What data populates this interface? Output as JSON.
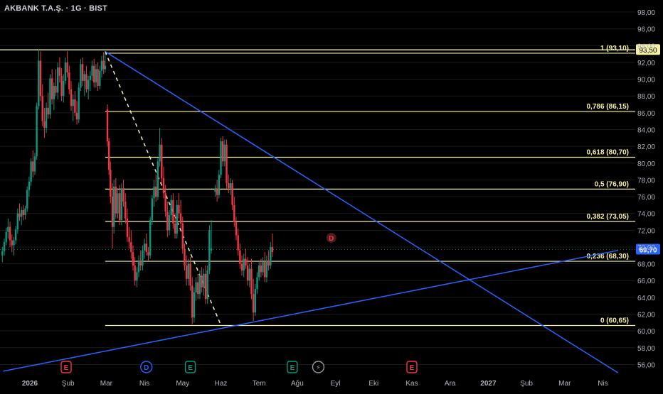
{
  "header": {
    "title": "AKBANK T.A.Ş. · 1G · BIST"
  },
  "colors": {
    "background": "#000000",
    "grid": "#1a1a1a",
    "axis_text": "#b2b5be",
    "up": "#089981",
    "down": "#f23645",
    "fib_line": "#f5f0a6",
    "trend_line": "#2962ff",
    "dashed_line": "#f5f0c0",
    "price_label_bg": "#f5f0a6",
    "current_label_bg": "#2962ff"
  },
  "chart_data": {
    "type": "candlestick",
    "symbol": "AKBANK T.A.Ş.",
    "interval": "1G",
    "exchange": "BIST",
    "y_axis": {
      "ylim": [
        55.2,
        99.0
      ],
      "ticks": [
        "98,00",
        "96,00",
        "94,00",
        "92,00",
        "90,00",
        "88,00",
        "86,00",
        "84,00",
        "82,00",
        "80,00",
        "78,00",
        "76,00",
        "74,00",
        "72,00",
        "70,00",
        "68,00",
        "66,00",
        "64,00",
        "62,00",
        "60,00",
        "58,00",
        "56,00"
      ]
    },
    "x_axis": {
      "labels": [
        {
          "text": "2026",
          "t": 0.0,
          "bold": true
        },
        {
          "text": "Şub",
          "t": 1.0
        },
        {
          "text": "Mar",
          "t": 2.0
        },
        {
          "text": "Nis",
          "t": 3.0
        },
        {
          "text": "May",
          "t": 4.0
        },
        {
          "text": "Haz",
          "t": 5.0
        },
        {
          "text": "Tem",
          "t": 6.0
        },
        {
          "text": "Ağu",
          "t": 7.0
        },
        {
          "text": "Eyl",
          "t": 8.0
        },
        {
          "text": "Eki",
          "t": 9.0
        },
        {
          "text": "Kas",
          "t": 10.0
        },
        {
          "text": "Ara",
          "t": 11.0
        },
        {
          "text": "2027",
          "t": 12.0,
          "bold": true
        },
        {
          "text": "Şub",
          "t": 13.0
        },
        {
          "text": "Mar",
          "t": 14.0
        },
        {
          "text": "Nis",
          "t": 15.0
        }
      ]
    },
    "fibonacci": [
      {
        "label": "1 (93,10)",
        "value": 93.1
      },
      {
        "label": "0,786 (86,15)",
        "value": 86.15
      },
      {
        "label": "0,618 (80,70)",
        "value": 80.7
      },
      {
        "label": "0,5 (76,90)",
        "value": 76.9
      },
      {
        "label": "0,382 (73,05)",
        "value": 73.05
      },
      {
        "label": "0,236 (68,30)",
        "value": 68.3
      },
      {
        "label": "0 (60,65)",
        "value": 60.65
      }
    ],
    "horizontal_level": {
      "value": 93.5,
      "label": "93,50"
    },
    "current_price": {
      "value": 69.7,
      "label": "69,70"
    },
    "trend_lines": [
      {
        "name": "descending",
        "points": [
          [
            1.97,
            93.3
          ],
          [
            15.4,
            55.0
          ]
        ]
      },
      {
        "name": "ascending",
        "points": [
          [
            -0.7,
            55.2
          ],
          [
            15.4,
            69.6
          ]
        ]
      }
    ],
    "dashed_line": {
      "points": [
        [
          1.97,
          93.3
        ],
        [
          5.0,
          60.7
        ]
      ]
    },
    "events": [
      {
        "letter": "E",
        "t": 0.95,
        "kind": "earnings-red"
      },
      {
        "letter": "D",
        "t": 3.05,
        "kind": "dividend-blue"
      },
      {
        "letter": "E",
        "t": 4.2,
        "kind": "earnings-green"
      },
      {
        "letter": "E",
        "t": 6.87,
        "kind": "earnings-green"
      },
      {
        "letter": "⚡",
        "t": 7.55,
        "kind": "split-grey"
      },
      {
        "letter": "E",
        "t": 10.0,
        "kind": "earnings-red"
      }
    ],
    "future_marker": {
      "letter": "D",
      "t": 7.89,
      "value": 71.1
    },
    "candles": [
      {
        "t": -0.72,
        "o": 69.0,
        "h": 70.0,
        "l": 68.2,
        "c": 69.5
      },
      {
        "t": -0.67,
        "o": 69.5,
        "h": 71.0,
        "l": 69.0,
        "c": 70.6
      },
      {
        "t": -0.62,
        "o": 70.6,
        "h": 72.3,
        "l": 70.2,
        "c": 71.8
      },
      {
        "t": -0.57,
        "o": 71.8,
        "h": 73.4,
        "l": 71.0,
        "c": 72.4
      },
      {
        "t": -0.52,
        "o": 72.4,
        "h": 73.0,
        "l": 70.0,
        "c": 70.8
      },
      {
        "t": -0.47,
        "o": 70.8,
        "h": 71.5,
        "l": 69.4,
        "c": 70.2
      },
      {
        "t": -0.42,
        "o": 70.2,
        "h": 71.2,
        "l": 69.0,
        "c": 70.8
      },
      {
        "t": -0.37,
        "o": 70.8,
        "h": 72.5,
        "l": 70.3,
        "c": 72.1
      },
      {
        "t": -0.32,
        "o": 72.1,
        "h": 74.6,
        "l": 71.6,
        "c": 74.0
      },
      {
        "t": -0.27,
        "o": 74.0,
        "h": 75.2,
        "l": 73.1,
        "c": 73.6
      },
      {
        "t": -0.22,
        "o": 73.6,
        "h": 74.8,
        "l": 72.6,
        "c": 74.4
      },
      {
        "t": -0.17,
        "o": 74.4,
        "h": 75.0,
        "l": 73.2,
        "c": 73.8
      },
      {
        "t": -0.12,
        "o": 73.8,
        "h": 74.9,
        "l": 73.3,
        "c": 74.6
      },
      {
        "t": -0.07,
        "o": 74.6,
        "h": 77.2,
        "l": 74.2,
        "c": 76.8
      },
      {
        "t": -0.02,
        "o": 76.8,
        "h": 78.4,
        "l": 76.0,
        "c": 77.8
      },
      {
        "t": 0.03,
        "o": 77.8,
        "h": 80.6,
        "l": 77.3,
        "c": 80.2
      },
      {
        "t": 0.08,
        "o": 80.2,
        "h": 81.5,
        "l": 78.3,
        "c": 79.0
      },
      {
        "t": 0.13,
        "o": 79.0,
        "h": 81.2,
        "l": 78.6,
        "c": 80.8
      },
      {
        "t": 0.18,
        "o": 80.8,
        "h": 87.2,
        "l": 80.4,
        "c": 86.8
      },
      {
        "t": 0.23,
        "o": 86.8,
        "h": 93.6,
        "l": 86.4,
        "c": 92.2
      },
      {
        "t": 0.28,
        "o": 92.2,
        "h": 93.3,
        "l": 87.4,
        "c": 88.0
      },
      {
        "t": 0.33,
        "o": 88.0,
        "h": 89.4,
        "l": 84.4,
        "c": 85.0
      },
      {
        "t": 0.38,
        "o": 85.0,
        "h": 86.6,
        "l": 83.0,
        "c": 84.2
      },
      {
        "t": 0.43,
        "o": 84.2,
        "h": 87.2,
        "l": 83.6,
        "c": 86.6
      },
      {
        "t": 0.48,
        "o": 86.6,
        "h": 88.4,
        "l": 85.3,
        "c": 85.8
      },
      {
        "t": 0.53,
        "o": 85.8,
        "h": 90.6,
        "l": 85.3,
        "c": 90.1
      },
      {
        "t": 0.58,
        "o": 90.1,
        "h": 91.2,
        "l": 87.0,
        "c": 87.6
      },
      {
        "t": 0.63,
        "o": 87.6,
        "h": 89.6,
        "l": 86.3,
        "c": 89.2
      },
      {
        "t": 0.68,
        "o": 89.2,
        "h": 91.2,
        "l": 88.0,
        "c": 88.4
      },
      {
        "t": 0.73,
        "o": 88.4,
        "h": 92.0,
        "l": 87.6,
        "c": 91.4
      },
      {
        "t": 0.78,
        "o": 91.4,
        "h": 92.6,
        "l": 89.6,
        "c": 90.4
      },
      {
        "t": 0.83,
        "o": 90.4,
        "h": 91.3,
        "l": 87.4,
        "c": 88.0
      },
      {
        "t": 0.88,
        "o": 88.0,
        "h": 90.6,
        "l": 87.2,
        "c": 89.8
      },
      {
        "t": 0.93,
        "o": 89.8,
        "h": 92.6,
        "l": 89.4,
        "c": 92.0
      },
      {
        "t": 0.98,
        "o": 92.0,
        "h": 93.3,
        "l": 90.2,
        "c": 90.8
      },
      {
        "t": 1.03,
        "o": 90.8,
        "h": 91.6,
        "l": 88.2,
        "c": 88.8
      },
      {
        "t": 1.08,
        "o": 88.8,
        "h": 89.8,
        "l": 86.2,
        "c": 86.8
      },
      {
        "t": 1.13,
        "o": 86.8,
        "h": 88.2,
        "l": 85.0,
        "c": 87.6
      },
      {
        "t": 1.18,
        "o": 87.6,
        "h": 88.6,
        "l": 85.6,
        "c": 86.0
      },
      {
        "t": 1.23,
        "o": 86.0,
        "h": 87.4,
        "l": 84.6,
        "c": 85.2
      },
      {
        "t": 1.28,
        "o": 85.2,
        "h": 89.6,
        "l": 84.8,
        "c": 89.0
      },
      {
        "t": 1.33,
        "o": 89.0,
        "h": 92.4,
        "l": 88.6,
        "c": 91.8
      },
      {
        "t": 1.38,
        "o": 91.8,
        "h": 92.6,
        "l": 89.2,
        "c": 89.8
      },
      {
        "t": 1.43,
        "o": 89.8,
        "h": 91.0,
        "l": 88.0,
        "c": 90.6
      },
      {
        "t": 1.48,
        "o": 90.6,
        "h": 91.6,
        "l": 88.4,
        "c": 88.8
      },
      {
        "t": 1.53,
        "o": 88.8,
        "h": 90.4,
        "l": 87.6,
        "c": 89.9
      },
      {
        "t": 1.58,
        "o": 89.9,
        "h": 91.0,
        "l": 88.6,
        "c": 90.4
      },
      {
        "t": 1.63,
        "o": 90.4,
        "h": 92.2,
        "l": 89.8,
        "c": 91.6
      },
      {
        "t": 1.68,
        "o": 91.6,
        "h": 92.4,
        "l": 89.0,
        "c": 89.6
      },
      {
        "t": 1.73,
        "o": 89.6,
        "h": 91.8,
        "l": 89.0,
        "c": 91.2
      },
      {
        "t": 1.78,
        "o": 91.2,
        "h": 92.0,
        "l": 88.6,
        "c": 89.2
      },
      {
        "t": 1.83,
        "o": 89.2,
        "h": 91.6,
        "l": 88.8,
        "c": 91.0
      },
      {
        "t": 1.88,
        "o": 91.0,
        "h": 92.8,
        "l": 90.2,
        "c": 92.2
      },
      {
        "t": 1.93,
        "o": 92.2,
        "h": 93.2,
        "l": 90.6,
        "c": 91.2
      },
      {
        "t": 1.97,
        "o": 91.2,
        "h": 93.3,
        "l": 90.8,
        "c": 91.6
      },
      {
        "t": 2.03,
        "o": 86.4,
        "h": 87.0,
        "l": 82.0,
        "c": 82.6
      },
      {
        "t": 2.07,
        "o": 82.6,
        "h": 83.0,
        "l": 78.6,
        "c": 79.2
      },
      {
        "t": 2.11,
        "o": 79.2,
        "h": 80.2,
        "l": 75.2,
        "c": 76.0
      },
      {
        "t": 2.16,
        "o": 76.0,
        "h": 77.6,
        "l": 69.8,
        "c": 72.4
      },
      {
        "t": 2.2,
        "o": 72.4,
        "h": 78.0,
        "l": 71.6,
        "c": 77.2
      },
      {
        "t": 2.25,
        "o": 77.2,
        "h": 78.2,
        "l": 73.4,
        "c": 74.0
      },
      {
        "t": 2.3,
        "o": 74.0,
        "h": 77.0,
        "l": 73.4,
        "c": 76.4
      },
      {
        "t": 2.35,
        "o": 76.4,
        "h": 77.4,
        "l": 72.6,
        "c": 73.2
      },
      {
        "t": 2.4,
        "o": 73.2,
        "h": 77.6,
        "l": 72.6,
        "c": 77.0
      },
      {
        "t": 2.45,
        "o": 77.0,
        "h": 78.0,
        "l": 74.8,
        "c": 75.4
      },
      {
        "t": 2.5,
        "o": 75.4,
        "h": 76.4,
        "l": 72.8,
        "c": 73.4
      },
      {
        "t": 2.55,
        "o": 73.4,
        "h": 74.6,
        "l": 70.6,
        "c": 71.2
      },
      {
        "t": 2.6,
        "o": 71.2,
        "h": 72.4,
        "l": 69.8,
        "c": 70.6
      },
      {
        "t": 2.65,
        "o": 70.6,
        "h": 72.0,
        "l": 68.6,
        "c": 69.4
      },
      {
        "t": 2.7,
        "o": 69.4,
        "h": 70.2,
        "l": 67.2,
        "c": 67.8
      },
      {
        "t": 2.75,
        "o": 67.8,
        "h": 68.8,
        "l": 65.4,
        "c": 66.0
      },
      {
        "t": 2.8,
        "o": 66.0,
        "h": 67.6,
        "l": 65.2,
        "c": 67.0
      },
      {
        "t": 2.85,
        "o": 67.0,
        "h": 69.0,
        "l": 66.4,
        "c": 68.4
      },
      {
        "t": 2.9,
        "o": 68.4,
        "h": 69.6,
        "l": 67.2,
        "c": 67.8
      },
      {
        "t": 2.95,
        "o": 67.8,
        "h": 70.2,
        "l": 67.2,
        "c": 69.6
      },
      {
        "t": 3.0,
        "o": 69.6,
        "h": 71.0,
        "l": 68.6,
        "c": 70.4
      },
      {
        "t": 3.05,
        "o": 70.4,
        "h": 71.6,
        "l": 69.0,
        "c": 69.4
      },
      {
        "t": 3.1,
        "o": 69.4,
        "h": 70.0,
        "l": 68.4,
        "c": 69.0
      },
      {
        "t": 3.15,
        "o": 69.0,
        "h": 73.6,
        "l": 68.6,
        "c": 73.2
      },
      {
        "t": 3.2,
        "o": 73.2,
        "h": 76.2,
        "l": 72.6,
        "c": 75.8
      },
      {
        "t": 3.25,
        "o": 75.8,
        "h": 78.0,
        "l": 74.8,
        "c": 77.2
      },
      {
        "t": 3.3,
        "o": 77.2,
        "h": 78.6,
        "l": 75.4,
        "c": 76.0
      },
      {
        "t": 3.35,
        "o": 76.0,
        "h": 80.6,
        "l": 75.6,
        "c": 80.2
      },
      {
        "t": 3.4,
        "o": 80.2,
        "h": 84.2,
        "l": 79.6,
        "c": 82.2
      },
      {
        "t": 3.45,
        "o": 82.2,
        "h": 83.0,
        "l": 77.6,
        "c": 78.2
      },
      {
        "t": 3.5,
        "o": 78.2,
        "h": 79.6,
        "l": 75.8,
        "c": 76.4
      },
      {
        "t": 3.55,
        "o": 76.4,
        "h": 77.4,
        "l": 73.6,
        "c": 74.2
      },
      {
        "t": 3.6,
        "o": 74.2,
        "h": 75.4,
        "l": 71.2,
        "c": 72.0
      },
      {
        "t": 3.65,
        "o": 72.0,
        "h": 74.4,
        "l": 71.4,
        "c": 73.8
      },
      {
        "t": 3.7,
        "o": 73.8,
        "h": 76.2,
        "l": 73.2,
        "c": 75.6
      },
      {
        "t": 3.75,
        "o": 75.6,
        "h": 76.4,
        "l": 72.2,
        "c": 72.8
      },
      {
        "t": 3.8,
        "o": 72.8,
        "h": 74.0,
        "l": 71.0,
        "c": 71.6
      },
      {
        "t": 3.85,
        "o": 71.6,
        "h": 75.6,
        "l": 71.0,
        "c": 75.0
      },
      {
        "t": 3.9,
        "o": 75.0,
        "h": 76.4,
        "l": 73.4,
        "c": 74.0
      },
      {
        "t": 3.95,
        "o": 74.0,
        "h": 75.6,
        "l": 72.2,
        "c": 72.8
      },
      {
        "t": 4.0,
        "o": 72.8,
        "h": 73.6,
        "l": 69.2,
        "c": 69.8
      },
      {
        "t": 4.05,
        "o": 69.8,
        "h": 70.4,
        "l": 67.2,
        "c": 67.8
      },
      {
        "t": 4.1,
        "o": 67.8,
        "h": 69.0,
        "l": 65.4,
        "c": 66.2
      },
      {
        "t": 4.15,
        "o": 66.2,
        "h": 68.6,
        "l": 65.4,
        "c": 68.0
      },
      {
        "t": 4.2,
        "o": 68.0,
        "h": 68.8,
        "l": 64.8,
        "c": 65.4
      },
      {
        "t": 4.25,
        "o": 65.4,
        "h": 66.4,
        "l": 60.8,
        "c": 61.6
      },
      {
        "t": 4.3,
        "o": 61.6,
        "h": 65.2,
        "l": 61.0,
        "c": 64.6
      },
      {
        "t": 4.35,
        "o": 64.6,
        "h": 66.4,
        "l": 63.6,
        "c": 65.8
      },
      {
        "t": 4.4,
        "o": 65.8,
        "h": 66.8,
        "l": 63.8,
        "c": 64.4
      },
      {
        "t": 4.45,
        "o": 64.4,
        "h": 67.2,
        "l": 63.8,
        "c": 66.6
      },
      {
        "t": 4.5,
        "o": 66.6,
        "h": 67.6,
        "l": 64.6,
        "c": 65.2
      },
      {
        "t": 4.55,
        "o": 65.2,
        "h": 67.4,
        "l": 64.2,
        "c": 66.8
      },
      {
        "t": 4.6,
        "o": 66.8,
        "h": 67.8,
        "l": 63.2,
        "c": 63.8
      },
      {
        "t": 4.65,
        "o": 63.8,
        "h": 67.8,
        "l": 63.2,
        "c": 67.2
      },
      {
        "t": 4.7,
        "o": 67.2,
        "h": 72.6,
        "l": 66.8,
        "c": 72.0
      },
      {
        "t": 4.75,
        "o": 69.6,
        "h": 73.2,
        "l": 69.2,
        "c": 69.8
      },
      {
        "t": 4.85,
        "o": 76.6,
        "h": 77.4,
        "l": 76.0,
        "c": 77.0
      },
      {
        "t": 4.9,
        "o": 77.0,
        "h": 78.0,
        "l": 75.4,
        "c": 76.2
      },
      {
        "t": 4.95,
        "o": 76.2,
        "h": 79.2,
        "l": 75.8,
        "c": 78.6
      },
      {
        "t": 5.0,
        "o": 78.6,
        "h": 83.0,
        "l": 78.2,
        "c": 82.6
      },
      {
        "t": 5.05,
        "o": 82.6,
        "h": 83.2,
        "l": 79.6,
        "c": 80.2
      },
      {
        "t": 5.1,
        "o": 80.2,
        "h": 82.8,
        "l": 79.6,
        "c": 82.2
      },
      {
        "t": 5.15,
        "o": 82.2,
        "h": 82.8,
        "l": 77.0,
        "c": 77.6
      },
      {
        "t": 5.2,
        "o": 77.6,
        "h": 78.6,
        "l": 76.4,
        "c": 77.0
      },
      {
        "t": 5.25,
        "o": 77.0,
        "h": 78.2,
        "l": 76.2,
        "c": 77.6
      },
      {
        "t": 5.3,
        "o": 77.6,
        "h": 78.0,
        "l": 74.4,
        "c": 75.0
      },
      {
        "t": 5.35,
        "o": 75.0,
        "h": 76.0,
        "l": 72.4,
        "c": 73.0
      },
      {
        "t": 5.4,
        "o": 73.0,
        "h": 73.6,
        "l": 70.8,
        "c": 71.4
      },
      {
        "t": 5.45,
        "o": 71.4,
        "h": 72.2,
        "l": 69.0,
        "c": 69.6
      },
      {
        "t": 5.5,
        "o": 69.6,
        "h": 70.4,
        "l": 67.4,
        "c": 68.0
      },
      {
        "t": 5.55,
        "o": 68.0,
        "h": 69.0,
        "l": 66.6,
        "c": 67.2
      },
      {
        "t": 5.6,
        "o": 67.2,
        "h": 69.2,
        "l": 66.4,
        "c": 68.6
      },
      {
        "t": 5.65,
        "o": 68.6,
        "h": 69.8,
        "l": 67.4,
        "c": 67.8
      },
      {
        "t": 5.7,
        "o": 67.8,
        "h": 68.8,
        "l": 65.4,
        "c": 66.0
      },
      {
        "t": 5.75,
        "o": 66.0,
        "h": 68.0,
        "l": 65.2,
        "c": 67.4
      },
      {
        "t": 5.8,
        "o": 67.4,
        "h": 68.6,
        "l": 63.8,
        "c": 64.4
      },
      {
        "t": 5.85,
        "o": 64.4,
        "h": 66.2,
        "l": 61.2,
        "c": 62.2
      },
      {
        "t": 5.9,
        "o": 62.2,
        "h": 65.6,
        "l": 61.8,
        "c": 65.0
      },
      {
        "t": 5.95,
        "o": 65.0,
        "h": 67.0,
        "l": 64.4,
        "c": 66.4
      },
      {
        "t": 6.0,
        "o": 66.4,
        "h": 68.4,
        "l": 66.0,
        "c": 67.8
      },
      {
        "t": 6.05,
        "o": 67.8,
        "h": 68.6,
        "l": 66.4,
        "c": 67.0
      },
      {
        "t": 6.1,
        "o": 67.0,
        "h": 68.8,
        "l": 66.6,
        "c": 68.2
      },
      {
        "t": 6.15,
        "o": 68.2,
        "h": 69.4,
        "l": 65.8,
        "c": 66.4
      },
      {
        "t": 6.2,
        "o": 66.4,
        "h": 69.0,
        "l": 65.8,
        "c": 68.4
      },
      {
        "t": 6.25,
        "o": 68.4,
        "h": 69.6,
        "l": 67.2,
        "c": 67.8
      },
      {
        "t": 6.3,
        "o": 67.8,
        "h": 70.6,
        "l": 67.4,
        "c": 70.0
      },
      {
        "t": 6.35,
        "o": 70.0,
        "h": 71.6,
        "l": 68.8,
        "c": 69.4
      }
    ]
  }
}
